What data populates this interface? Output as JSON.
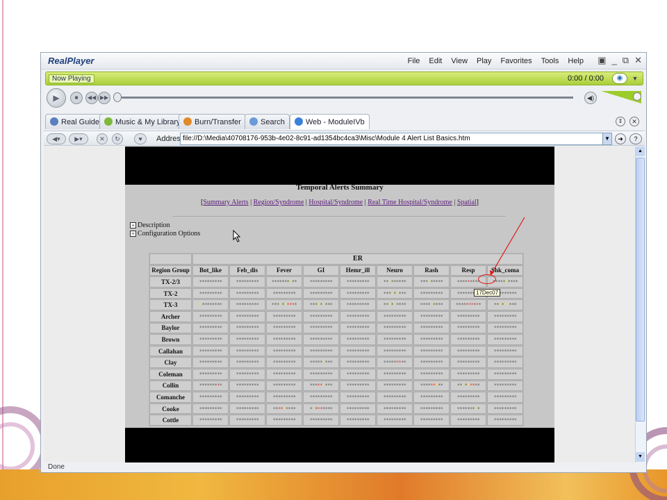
{
  "window": {
    "app_name": "RealPlayer",
    "menu": [
      "File",
      "Edit",
      "View",
      "Play",
      "Favorites",
      "Tools",
      "Help"
    ]
  },
  "now_playing": {
    "label": "Now Playing",
    "time": "0:00 / 0:00"
  },
  "tabs": [
    "Real Guide",
    "Music & My Library",
    "Burn/Transfer",
    "Search",
    "Web - ModuleIVb"
  ],
  "address": {
    "label": "Address",
    "value": "file://D:\\Media\\40708176-953b-4e02-8c91-ad1354bc4ca3\\Misc\\Module 4 Alert List Basics.htm"
  },
  "status": "Done",
  "page": {
    "title": "Temporal Alerts Summary",
    "links": [
      "Summary Alerts",
      "Region/Syndrome",
      "Hospital/Syndrome",
      "Real Time Hospital/Syndrome",
      "Spatial"
    ],
    "expanders": [
      "Description",
      "Configuration Options"
    ],
    "table": {
      "group_header": "ER",
      "columns": [
        "Region Group",
        "Bot_like",
        "Feb_dis",
        "Fever",
        "GI",
        "Hemr_ill",
        "Neuro",
        "Rash",
        "Resp",
        "Shk_coma"
      ],
      "rows": [
        {
          "label": "TX-2/3",
          "cells": [
            "*********",
            "*********",
            "*******y**",
            "*********",
            "*********",
            "**y******",
            "***y*****",
            "****r****",
            "*****y****"
          ]
        },
        {
          "label": "TX-2",
          "cells": [
            "*********",
            "*********",
            "*********",
            "*********",
            "*********",
            "***y*y***",
            "*********",
            "*********",
            "*********"
          ]
        },
        {
          "label": "TX-3",
          "cells": [
            "y********",
            "*********",
            "***y*yrrr*",
            "***y*y***",
            "*********",
            "**y*y****",
            "****y****",
            "****rrr*r*",
            "**y*yy***"
          ]
        },
        {
          "label": "Archer",
          "cells": [
            "*********",
            "*********",
            "*********",
            "*********",
            "*********",
            "*********",
            "*********",
            "*********",
            "*********"
          ]
        },
        {
          "label": "Baylor",
          "cells": [
            "*********",
            "*********",
            "*********",
            "*********",
            "*********",
            "*********",
            "*********",
            "*********",
            "*********"
          ]
        },
        {
          "label": "Brown",
          "cells": [
            "*********",
            "*********",
            "*********",
            "*********",
            "*********",
            "*********",
            "*********",
            "*********",
            "*********"
          ]
        },
        {
          "label": "Callahan",
          "cells": [
            "*********",
            "*********",
            "*********",
            "*********",
            "*********",
            "*********",
            "*********",
            "*********",
            "*********"
          ]
        },
        {
          "label": "Clay",
          "cells": [
            "*********",
            "*********",
            "*********",
            "*****y***",
            "*********",
            "*****rr**",
            "*********",
            "*********",
            "*********"
          ]
        },
        {
          "label": "Coleman",
          "cells": [
            "*********",
            "*********",
            "*********",
            "*********",
            "*********",
            "*********",
            "*********",
            "*********",
            "*********"
          ]
        },
        {
          "label": "Collin",
          "cells": [
            "*******r*",
            "*********",
            "*********",
            "***rry***",
            "*********",
            "*********",
            "****rry**",
            "**y*yrr**",
            "*********"
          ]
        },
        {
          "label": "Comanche",
          "cells": [
            "*********",
            "*********",
            "*********",
            "*********",
            "*********",
            "*********",
            "*********",
            "*********",
            "*********"
          ]
        },
        {
          "label": "Cooke",
          "cells": [
            "*********",
            "*********",
            "**rry****",
            "*y*rr****",
            "*********",
            "*********",
            "*********",
            "*******y*",
            "*********"
          ]
        },
        {
          "label": "Cottle",
          "cells": [
            "*********",
            "*********",
            "*********",
            "*********",
            "*********",
            "*********",
            "*********",
            "*********",
            "*********"
          ]
        }
      ]
    },
    "tooltip": "17Dec07"
  },
  "colors": {
    "accent_green": "#a9cf3a",
    "alert_red": "#ee2a2a",
    "alert_yellow": "#f2e23a",
    "link": "#5a1a7a",
    "annotation": "#e01818"
  }
}
